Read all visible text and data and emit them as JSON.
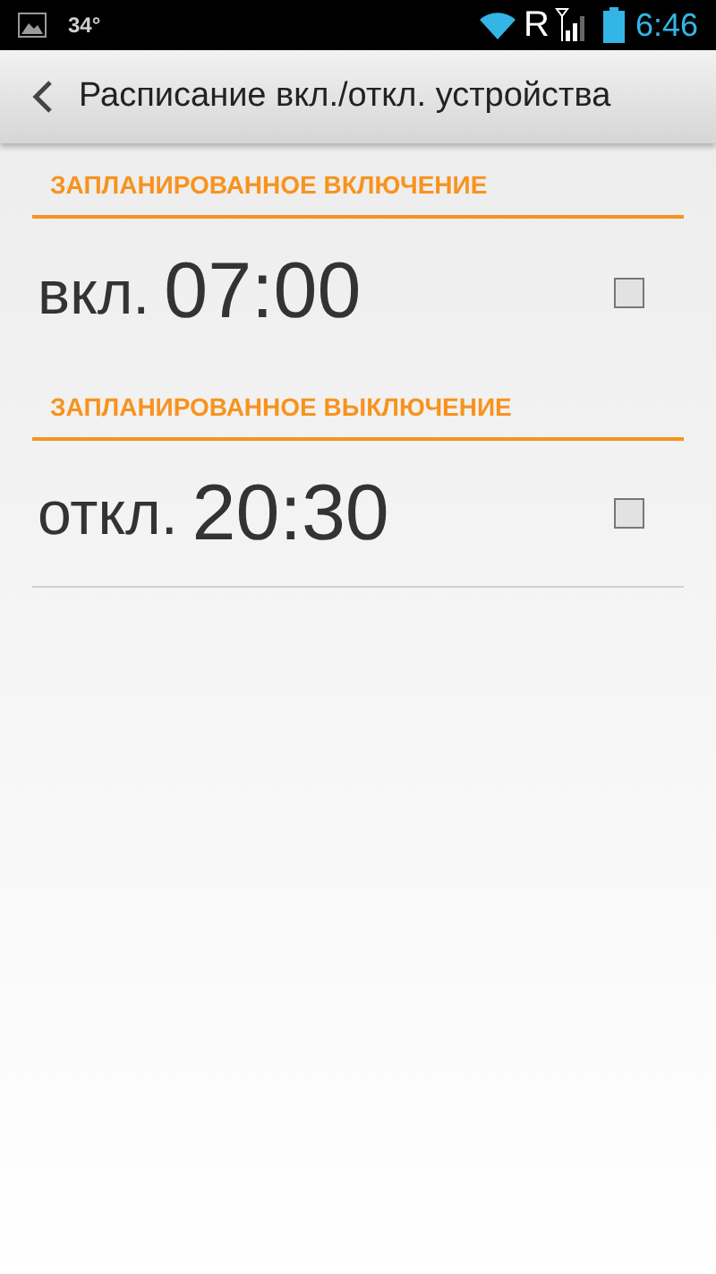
{
  "status_bar": {
    "temperature": "34°",
    "roaming": "R",
    "time": "6:46"
  },
  "title_bar": {
    "title": "Расписание вкл./откл. устройства"
  },
  "sections": [
    {
      "header": "ЗАПЛАНИРОВАННОЕ ВКЛЮЧЕНИЕ",
      "label": "вкл.",
      "time": "07:00",
      "checked": false
    },
    {
      "header": "ЗАПЛАНИРОВАННОЕ ВЫКЛЮЧЕНИЕ",
      "label": "откл.",
      "time": "20:30",
      "checked": false
    }
  ]
}
